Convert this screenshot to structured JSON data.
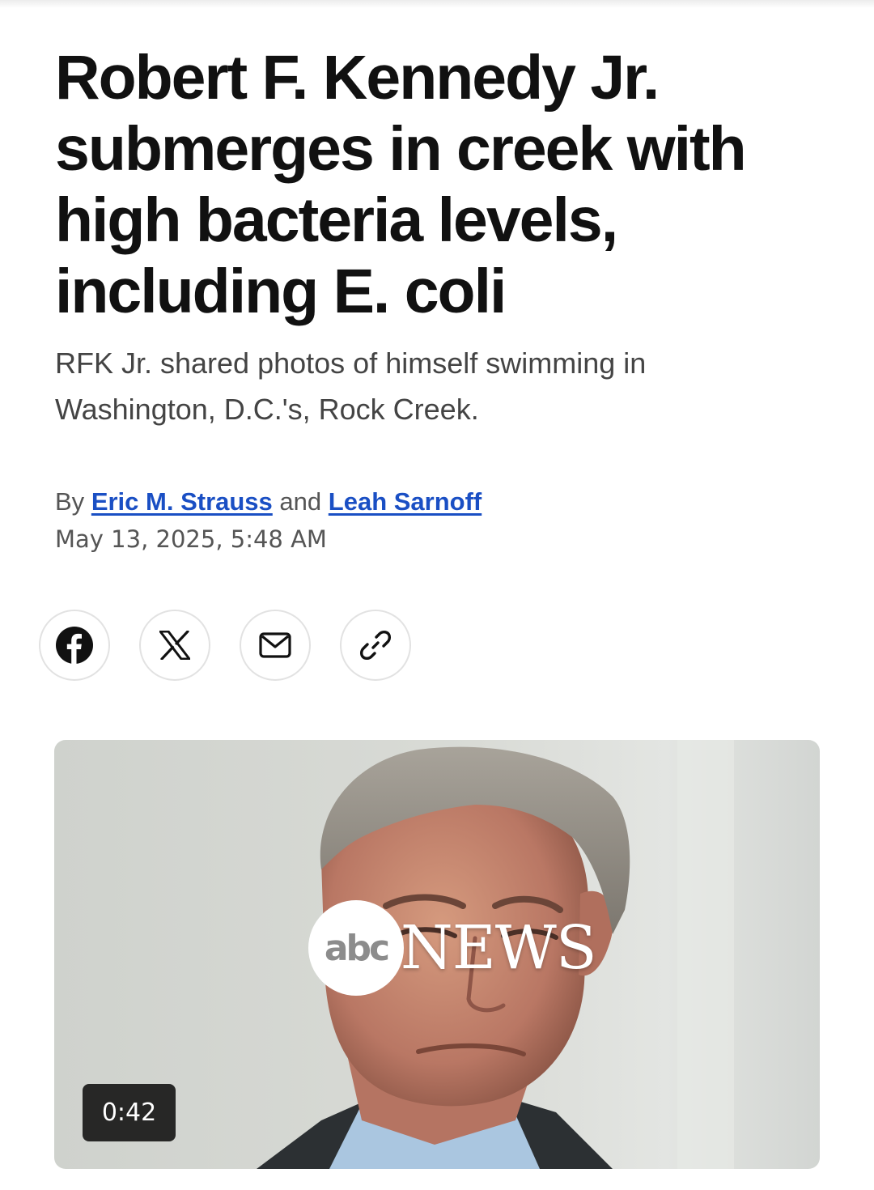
{
  "article": {
    "headline": "Robert F. Kennedy Jr. submerges in creek with high bacteria levels, including E. coli",
    "subheadline": "RFK Jr. shared photos of himself swimming in Washington, D.C.'s, Rock Creek.",
    "byline_prefix": "By",
    "byline_joiner": "and",
    "authors": [
      "Eric M. Strauss",
      "Leah Sarnoff"
    ],
    "timestamp": "May 13, 2025, 5:48 AM"
  },
  "share": {
    "buttons": [
      {
        "icon": "facebook-icon"
      },
      {
        "icon": "x-icon"
      },
      {
        "icon": "mail-icon"
      },
      {
        "icon": "link-icon"
      }
    ]
  },
  "video": {
    "logo_left": "abc",
    "logo_right": "NEWS",
    "duration": "0:42"
  },
  "colors": {
    "headline": "#111111",
    "link": "#1a4fc4",
    "muted": "#555555"
  }
}
